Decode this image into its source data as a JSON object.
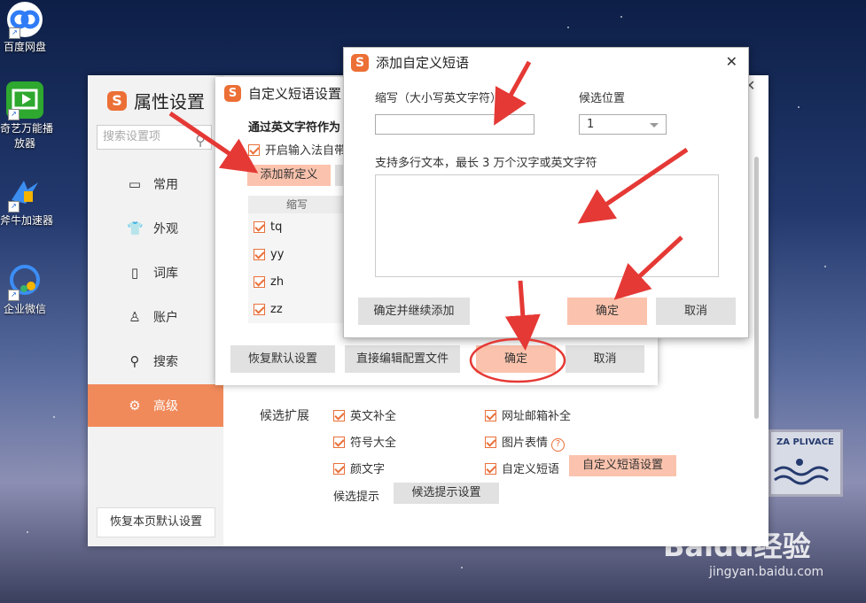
{
  "desktop": {
    "icons": [
      {
        "label": "百度网盘",
        "icon": "baidu-netdisk-icon"
      },
      {
        "label": "奇艺万能播",
        "label2": "放器",
        "icon": "iqiyi-player-icon"
      },
      {
        "label": "斧牛加速器",
        "icon": "accelerator-icon"
      },
      {
        "label": "企业微信",
        "icon": "wecom-icon"
      }
    ]
  },
  "settings": {
    "title": "属性设置",
    "search_placeholder": "搜索设置项",
    "nav": [
      {
        "label": "常用",
        "icon": "monitor-icon"
      },
      {
        "label": "外观",
        "icon": "shirt-icon"
      },
      {
        "label": "词库",
        "icon": "book-icon"
      },
      {
        "label": "账户",
        "icon": "user-icon"
      },
      {
        "label": "搜索",
        "icon": "search-icon"
      },
      {
        "label": "高级",
        "icon": "gear-icon",
        "active": true
      }
    ],
    "restore_page_default": "恢复本页默认设置",
    "candidate_expand_label": "候选扩展",
    "options": {
      "english_complete": "英文补全",
      "url_email_complete": "网址邮箱补全",
      "symbols": "符号大全",
      "image_emoji": "图片表情",
      "kaomoji": "颜文字",
      "custom_phrase": "自定义短语",
      "custom_phrase_settings_btn": "自定义短语设置"
    },
    "candidate_hint_label": "候选提示",
    "candidate_hint_settings_btn": "候选提示设置"
  },
  "phrase_window": {
    "title": "自定义短语设置",
    "section_head": "通过英文字符作为",
    "enable_checkbox": "开启输入法自带",
    "add_new_btn": "添加新定义",
    "table_header": "缩写",
    "rows": [
      "tq",
      "yy",
      "zh",
      "zz"
    ],
    "restore_default_btn": "恢复默认设置",
    "edit_config_btn": "直接编辑配置文件",
    "ok_btn": "确定",
    "cancel_btn": "取消"
  },
  "add_dialog": {
    "title": "添加自定义短语",
    "abbr_label": "缩写（大小写英文字符）",
    "abbr_value": "",
    "position_label": "候选位置",
    "position_value": "1",
    "text_label": "支持多行文本，最长 3 万个汉字或英文字符",
    "text_value": "",
    "ok_continue_btn": "确定并继续添加",
    "ok_btn": "确定",
    "cancel_btn": "取消"
  },
  "decor": {
    "sign_text": "ZA PLIVACE",
    "watermark": "Baidu经验",
    "watermark_url": "jingyan.baidu.com"
  },
  "colors": {
    "accent": "#ec6f35",
    "nav_active": "#f08a5b",
    "peach_button": "#fbc3ad",
    "annotation_red": "#e53935"
  }
}
